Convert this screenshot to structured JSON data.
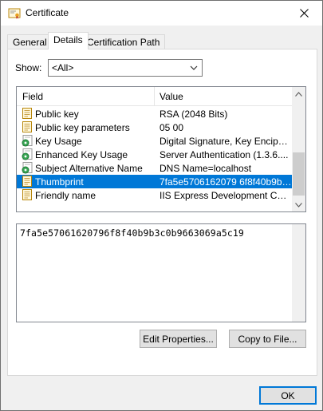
{
  "window": {
    "title": "Certificate",
    "close_label": "✕"
  },
  "tabs": [
    {
      "label": "General",
      "active": false
    },
    {
      "label": "Details",
      "active": true
    },
    {
      "label": "Certification Path",
      "active": false
    }
  ],
  "show": {
    "label": "Show:",
    "selected": "<All>"
  },
  "list": {
    "headers": {
      "field": "Field",
      "value": "Value"
    },
    "rows": [
      {
        "field": "Public key",
        "value": "RSA (2048 Bits)",
        "icon": "certificate-field-icon"
      },
      {
        "field": "Public key parameters",
        "value": "05 00",
        "icon": "certificate-field-icon"
      },
      {
        "field": "Key Usage",
        "value": "Digital Signature, Key Encipher...",
        "icon": "extension-icon"
      },
      {
        "field": "Enhanced Key Usage",
        "value": "Server Authentication (1.3.6....",
        "icon": "extension-icon"
      },
      {
        "field": "Subject Alternative Name",
        "value": "DNS Name=localhost",
        "icon": "extension-icon"
      },
      {
        "field": "Thumbprint",
        "value": "7fa5e5706162079 6f8f40b9b3...",
        "icon": "certificate-field-icon",
        "selected": true
      },
      {
        "field": "Friendly name",
        "value": "IIS Express Development Certi...",
        "icon": "certificate-field-icon"
      }
    ]
  },
  "detail": {
    "text": "7fa5e57061620796f8f40b9b3c0b9663069a5c19"
  },
  "buttons": {
    "edit_properties": "Edit Properties...",
    "copy_to_file": "Copy to File...",
    "ok": "OK"
  },
  "colors": {
    "selection": "#0078d7",
    "dialog_bg": "#f0f0f0"
  }
}
